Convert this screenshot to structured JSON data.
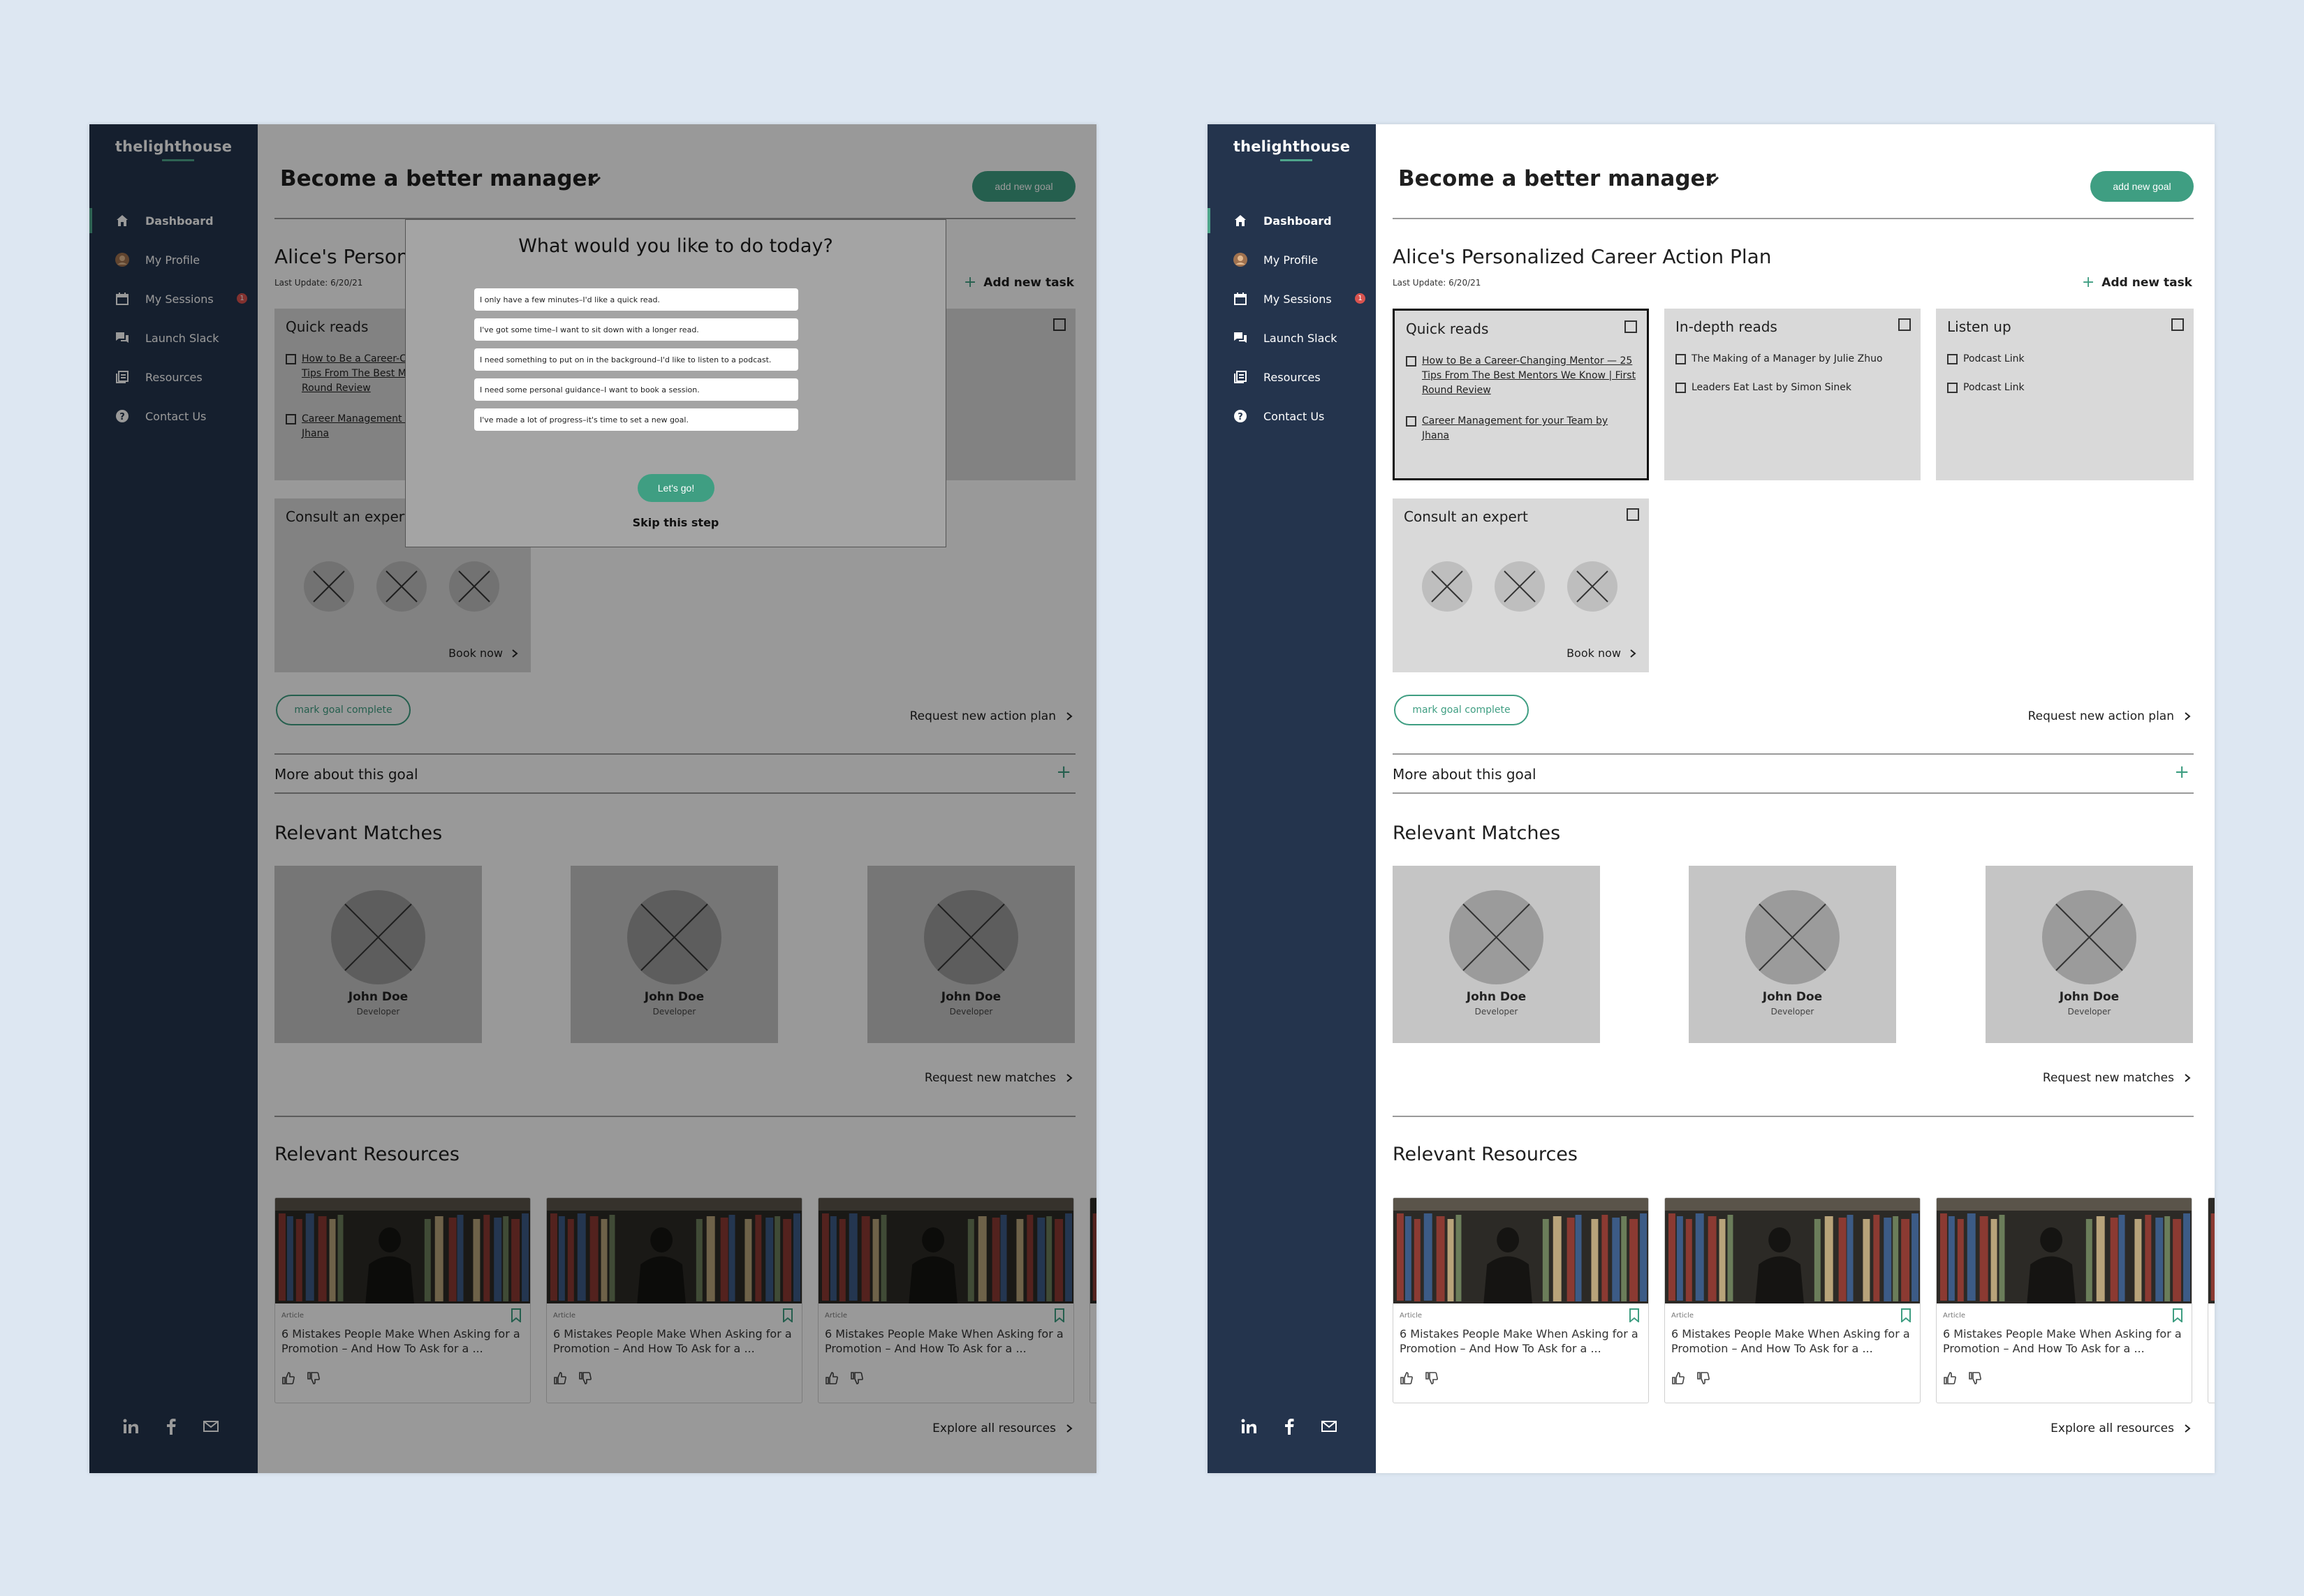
{
  "app": {
    "logo": "thelighthouse"
  },
  "sidebar": {
    "items": [
      {
        "label": "Dashboard",
        "icon": "home-icon"
      },
      {
        "label": "My Profile",
        "icon": "avatar-icon"
      },
      {
        "label": "My Sessions",
        "icon": "calendar-icon",
        "badge": "1"
      },
      {
        "label": "Launch Slack",
        "icon": "chat-icon"
      },
      {
        "label": "Resources",
        "icon": "book-icon"
      },
      {
        "label": "Contact Us",
        "icon": "help-icon"
      }
    ],
    "social": [
      "linkedin-icon",
      "facebook-icon",
      "mail-icon"
    ]
  },
  "header": {
    "title": "Become a better manager",
    "add_goal": "add new goal"
  },
  "plan": {
    "title": "Alice's Personalized Career Action Plan",
    "title_truncated": "Alice's Persona",
    "last_update": "Last Update: 6/20/21",
    "add_task": "Add new task"
  },
  "cards": {
    "quick_reads": {
      "title": "Quick reads",
      "tasks": [
        {
          "text": "How to Be a Career-Changing Mentor — 25 Tips From The Best Mentors We Know | First Round Review"
        },
        {
          "text": "Career Management for your Team by Jhana"
        }
      ]
    },
    "in_depth": {
      "title": "In-depth reads",
      "tasks": [
        {
          "text": "The Making of a Manager by Julie Zhuo"
        },
        {
          "text": "Leaders Eat Last by Simon Sinek"
        }
      ]
    },
    "listen": {
      "title": "Listen up",
      "tasks": [
        {
          "text": "Podcast Link"
        },
        {
          "text": "Podcast Link"
        }
      ]
    },
    "expert": {
      "title": "Consult an expert",
      "book_now": "Book now"
    }
  },
  "actions": {
    "mark_complete": "mark goal complete",
    "request_plan": "Request new action plan",
    "more_goal": "More about this goal",
    "request_matches": "Request new matches",
    "explore_resources": "Explore all resources"
  },
  "matches": {
    "title": "Relevant Matches",
    "items": [
      {
        "name": "John Doe",
        "role": "Developer"
      },
      {
        "name": "John Doe",
        "role": "Developer"
      },
      {
        "name": "John Doe",
        "role": "Developer"
      }
    ]
  },
  "resources": {
    "title": "Relevant Resources",
    "items": [
      {
        "type": "Article",
        "title": "6 Mistakes People Make When Asking for a Promotion – And How To Ask for a ..."
      },
      {
        "type": "Article",
        "title": "6 Mistakes People Make When Asking for a Promotion – And How To Ask for a ..."
      },
      {
        "type": "Article",
        "title": "6 Mistakes People Make When Asking for a Promotion – And How To Ask for a ..."
      }
    ]
  },
  "modal": {
    "title": "What would you like to do today?",
    "options": [
      "I only have a few minutes–I'd like a quick read.",
      "I've got some time–I want to sit down with a longer read.",
      "I need something to put on in the background–I'd like to listen to a podcast.",
      "I need some personal guidance–I want to book a session.",
      "I've made a lot of progress–it's time to set a new goal."
    ],
    "button": "Let's go!",
    "skip": "Skip this step"
  },
  "colors": {
    "sidebar": "#24344d",
    "accent": "#3f9e82",
    "background": "#dde7f2",
    "card": "#d9d9d9"
  }
}
